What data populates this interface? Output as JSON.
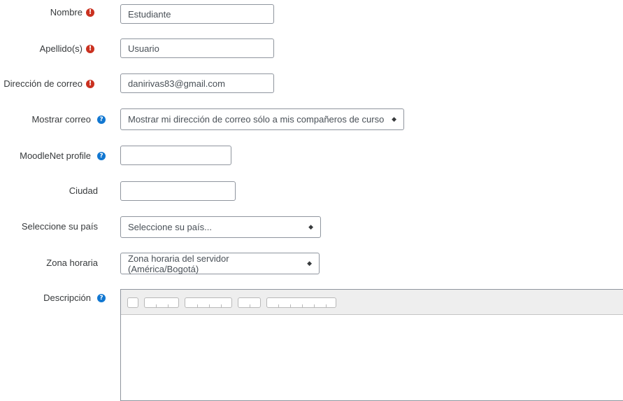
{
  "icons": {
    "required": "!",
    "help": "?"
  },
  "colors": {
    "required": "#ca3120",
    "help": "#1177d1",
    "border": "#8f959e"
  },
  "fields": {
    "nombre": {
      "label": "Nombre",
      "value": "Estudiante"
    },
    "apellido": {
      "label": "Apellido(s)",
      "value": "Usuario"
    },
    "correo": {
      "label": "Dirección de correo",
      "value": "danirivas83@gmail.com"
    },
    "mostrar_correo": {
      "label": "Mostrar correo",
      "value": "Mostrar mi dirección de correo sólo a mis compañeros de curso"
    },
    "moodlenet": {
      "label": "MoodleNet profile",
      "value": ""
    },
    "ciudad": {
      "label": "Ciudad",
      "value": ""
    },
    "pais": {
      "label": "Seleccione su país",
      "value": "Seleccione su país..."
    },
    "zona_horaria": {
      "label": "Zona horaria",
      "value": "Zona horaria del servidor (América/Bogotá)"
    },
    "descripcion": {
      "label": "Descripción"
    }
  },
  "select_caret": "◆"
}
